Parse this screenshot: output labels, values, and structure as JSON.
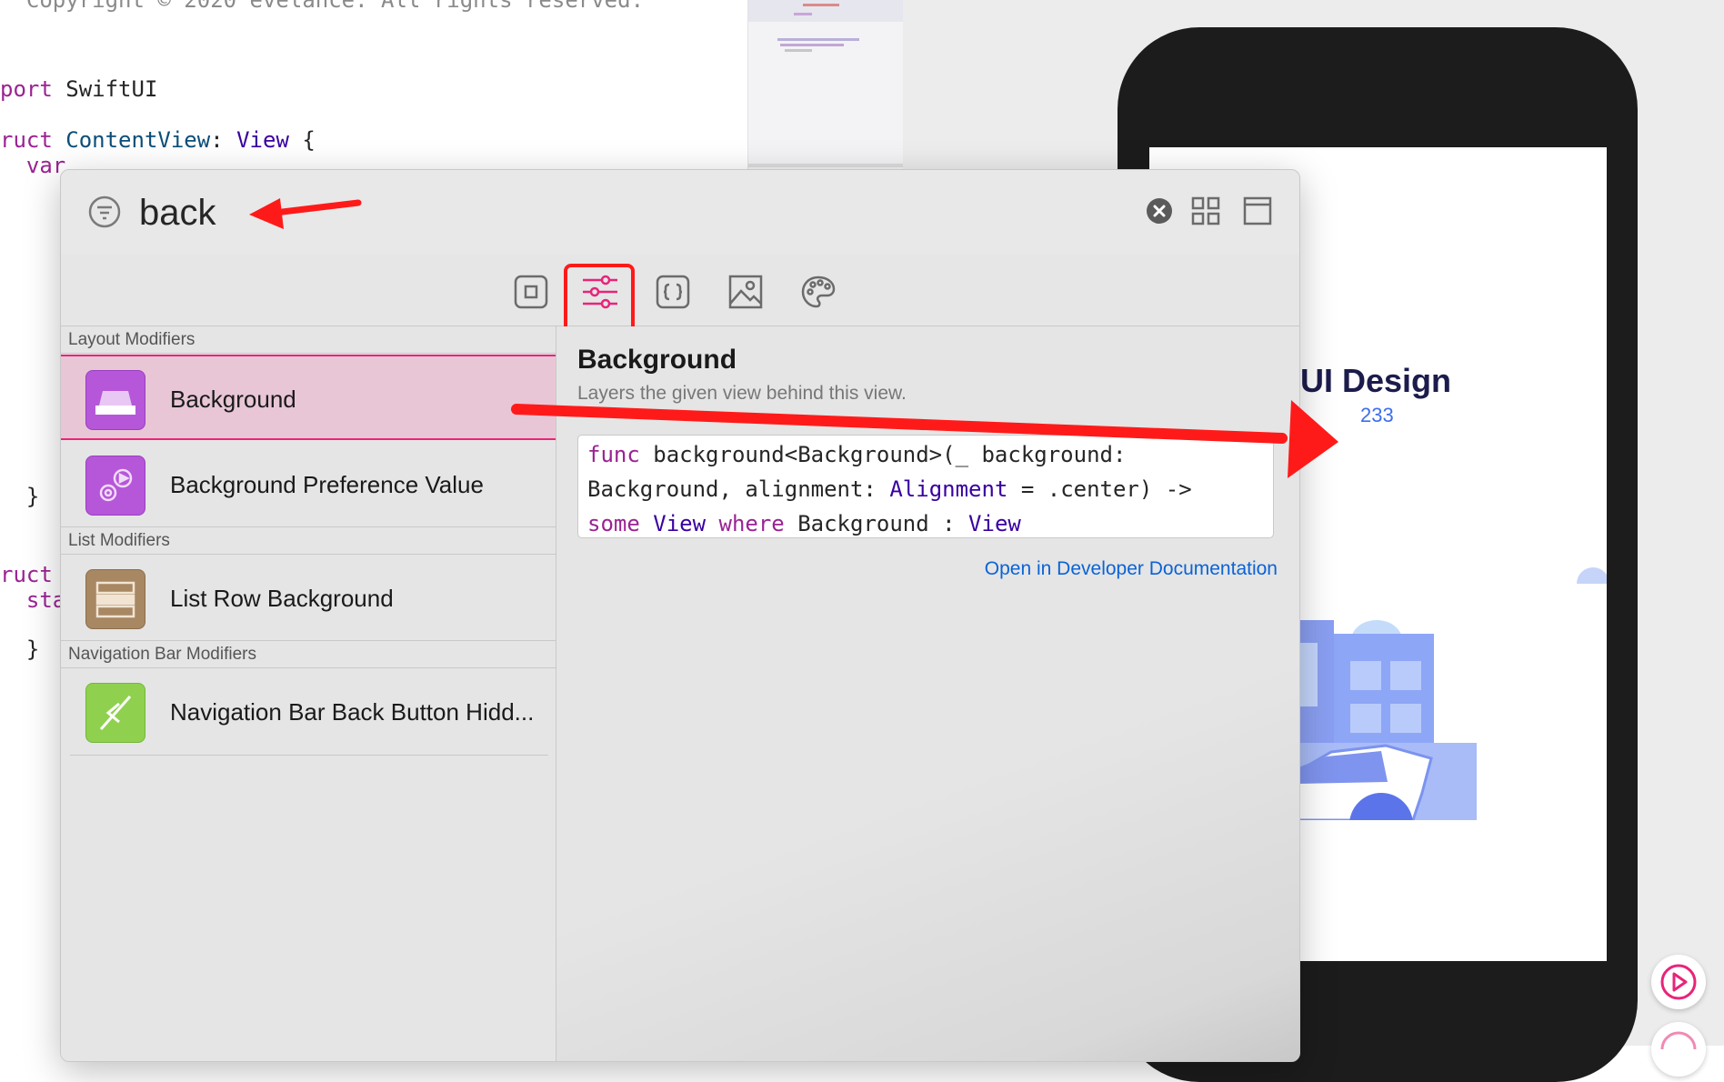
{
  "editor": {
    "lines": [
      {
        "parts": [
          {
            "t": "  Copyright © 2020 evelance. All rights reserved.",
            "c": "cm"
          }
        ]
      },
      {
        "parts": [
          {
            "t": "port",
            "c": "kw"
          },
          {
            "t": " SwiftUI",
            "c": ""
          }
        ]
      },
      {
        "parts": [
          {
            "t": "ruct",
            "c": "kw"
          },
          {
            "t": " ",
            "c": ""
          },
          {
            "t": "ContentView",
            "c": "ty2"
          },
          {
            "t": ": ",
            "c": ""
          },
          {
            "t": "View",
            "c": "ty"
          },
          {
            "t": " {",
            "c": ""
          }
        ]
      },
      {
        "parts": [
          {
            "t": "  var",
            "c": "kw"
          }
        ]
      },
      {
        "parts": [
          {
            "t": "  }",
            "c": ""
          }
        ]
      },
      {
        "parts": [
          {
            "t": "ruct",
            "c": "kw"
          }
        ]
      },
      {
        "parts": [
          {
            "t": "  sta",
            "c": "kw"
          }
        ]
      },
      {
        "parts": [
          {
            "t": "  }",
            "c": ""
          }
        ]
      }
    ]
  },
  "library": {
    "search": {
      "value": "back",
      "placeholder": "Filter"
    },
    "tabs": [
      {
        "name": "views-tab",
        "icon": "square-icon"
      },
      {
        "name": "modifiers-tab",
        "icon": "sliders-icon"
      },
      {
        "name": "snippets-tab",
        "icon": "braces-icon"
      },
      {
        "name": "media-tab",
        "icon": "image-icon"
      },
      {
        "name": "colors-tab",
        "icon": "palette-icon"
      }
    ],
    "sections": [
      {
        "title": "Layout Modifiers",
        "items": [
          {
            "label": "Background",
            "icon": "background-icon",
            "selected": true
          },
          {
            "label": "Background Preference Value",
            "icon": "preference-gear-icon",
            "selected": false
          }
        ]
      },
      {
        "title": "List Modifiers",
        "items": [
          {
            "label": "List Row Background",
            "icon": "list-row-icon",
            "selected": false
          }
        ]
      },
      {
        "title": "Navigation Bar Modifiers",
        "items": [
          {
            "label": "Navigation Bar Back Button Hidd...",
            "icon": "nav-back-hidden-icon",
            "selected": false
          }
        ]
      }
    ],
    "detail": {
      "title": "Background",
      "subtitle": "Layers the given view behind this view.",
      "signature": [
        [
          {
            "t": "func",
            "c": "kw"
          },
          {
            "t": " background<Background>(_ background:",
            "c": ""
          }
        ],
        [
          {
            "t": "Background, alignment: ",
            "c": ""
          },
          {
            "t": "Alignment",
            "c": "ty"
          },
          {
            "t": " = .center) ->",
            "c": ""
          }
        ],
        [
          {
            "t": "some",
            "c": "kw"
          },
          {
            "t": " ",
            "c": ""
          },
          {
            "t": "View",
            "c": "ty"
          },
          {
            "t": " ",
            "c": ""
          },
          {
            "t": "where",
            "c": "kw"
          },
          {
            "t": " Background : ",
            "c": ""
          },
          {
            "t": "View",
            "c": "ty"
          }
        ]
      ],
      "doc_link": "Open in Developer Documentation"
    }
  },
  "preview": {
    "title": "UI Design",
    "count": "233"
  },
  "colors": {
    "accent": "#e8247a",
    "link": "#0a63d6",
    "annotation": "#ff1a1a"
  }
}
